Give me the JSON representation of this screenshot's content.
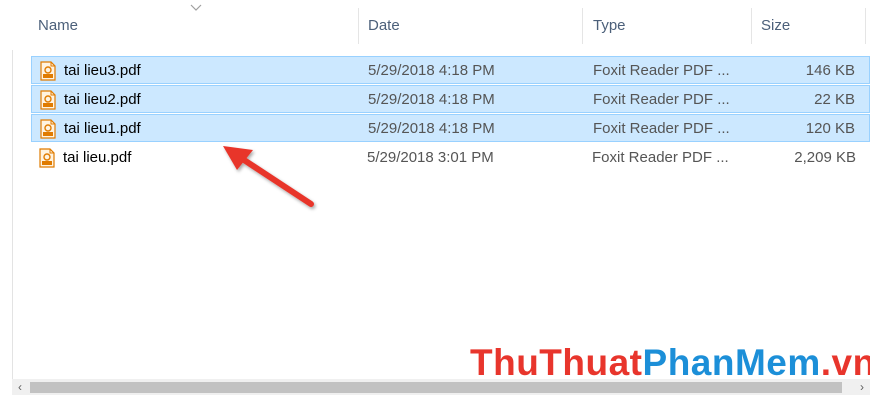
{
  "header": {
    "columns": [
      {
        "label": "Name"
      },
      {
        "label": "Date"
      },
      {
        "label": "Type"
      },
      {
        "label": "Size"
      }
    ]
  },
  "files": [
    {
      "name": "tai lieu3.pdf",
      "date": "5/29/2018 4:18 PM",
      "type": "Foxit Reader PDF ...",
      "size": "146 KB",
      "selected": true
    },
    {
      "name": "tai lieu2.pdf",
      "date": "5/29/2018 4:18 PM",
      "type": "Foxit Reader PDF ...",
      "size": "22 KB",
      "selected": true
    },
    {
      "name": "tai lieu1.pdf",
      "date": "5/29/2018 4:18 PM",
      "type": "Foxit Reader PDF ...",
      "size": "120 KB",
      "selected": true
    },
    {
      "name": "tai lieu.pdf",
      "date": "5/29/2018 3:01 PM",
      "type": "Foxit Reader PDF ...",
      "size": "2,209 KB",
      "selected": false
    }
  ],
  "icons": {
    "file": "pdf-file-icon",
    "sort": "sort-chevron-icon",
    "scroll_left": "scroll-left-icon",
    "scroll_right": "scroll-right-icon"
  },
  "colors": {
    "selection_fill": "#cce8ff",
    "selection_border": "#99d1ff",
    "annotation_arrow": "#e8352c",
    "watermark_primary": "#e8352c",
    "watermark_secondary": "#1c8fd8"
  },
  "watermark": {
    "part1": "ThuThuat",
    "part2": "PhanMem",
    "part3": ".vn"
  }
}
